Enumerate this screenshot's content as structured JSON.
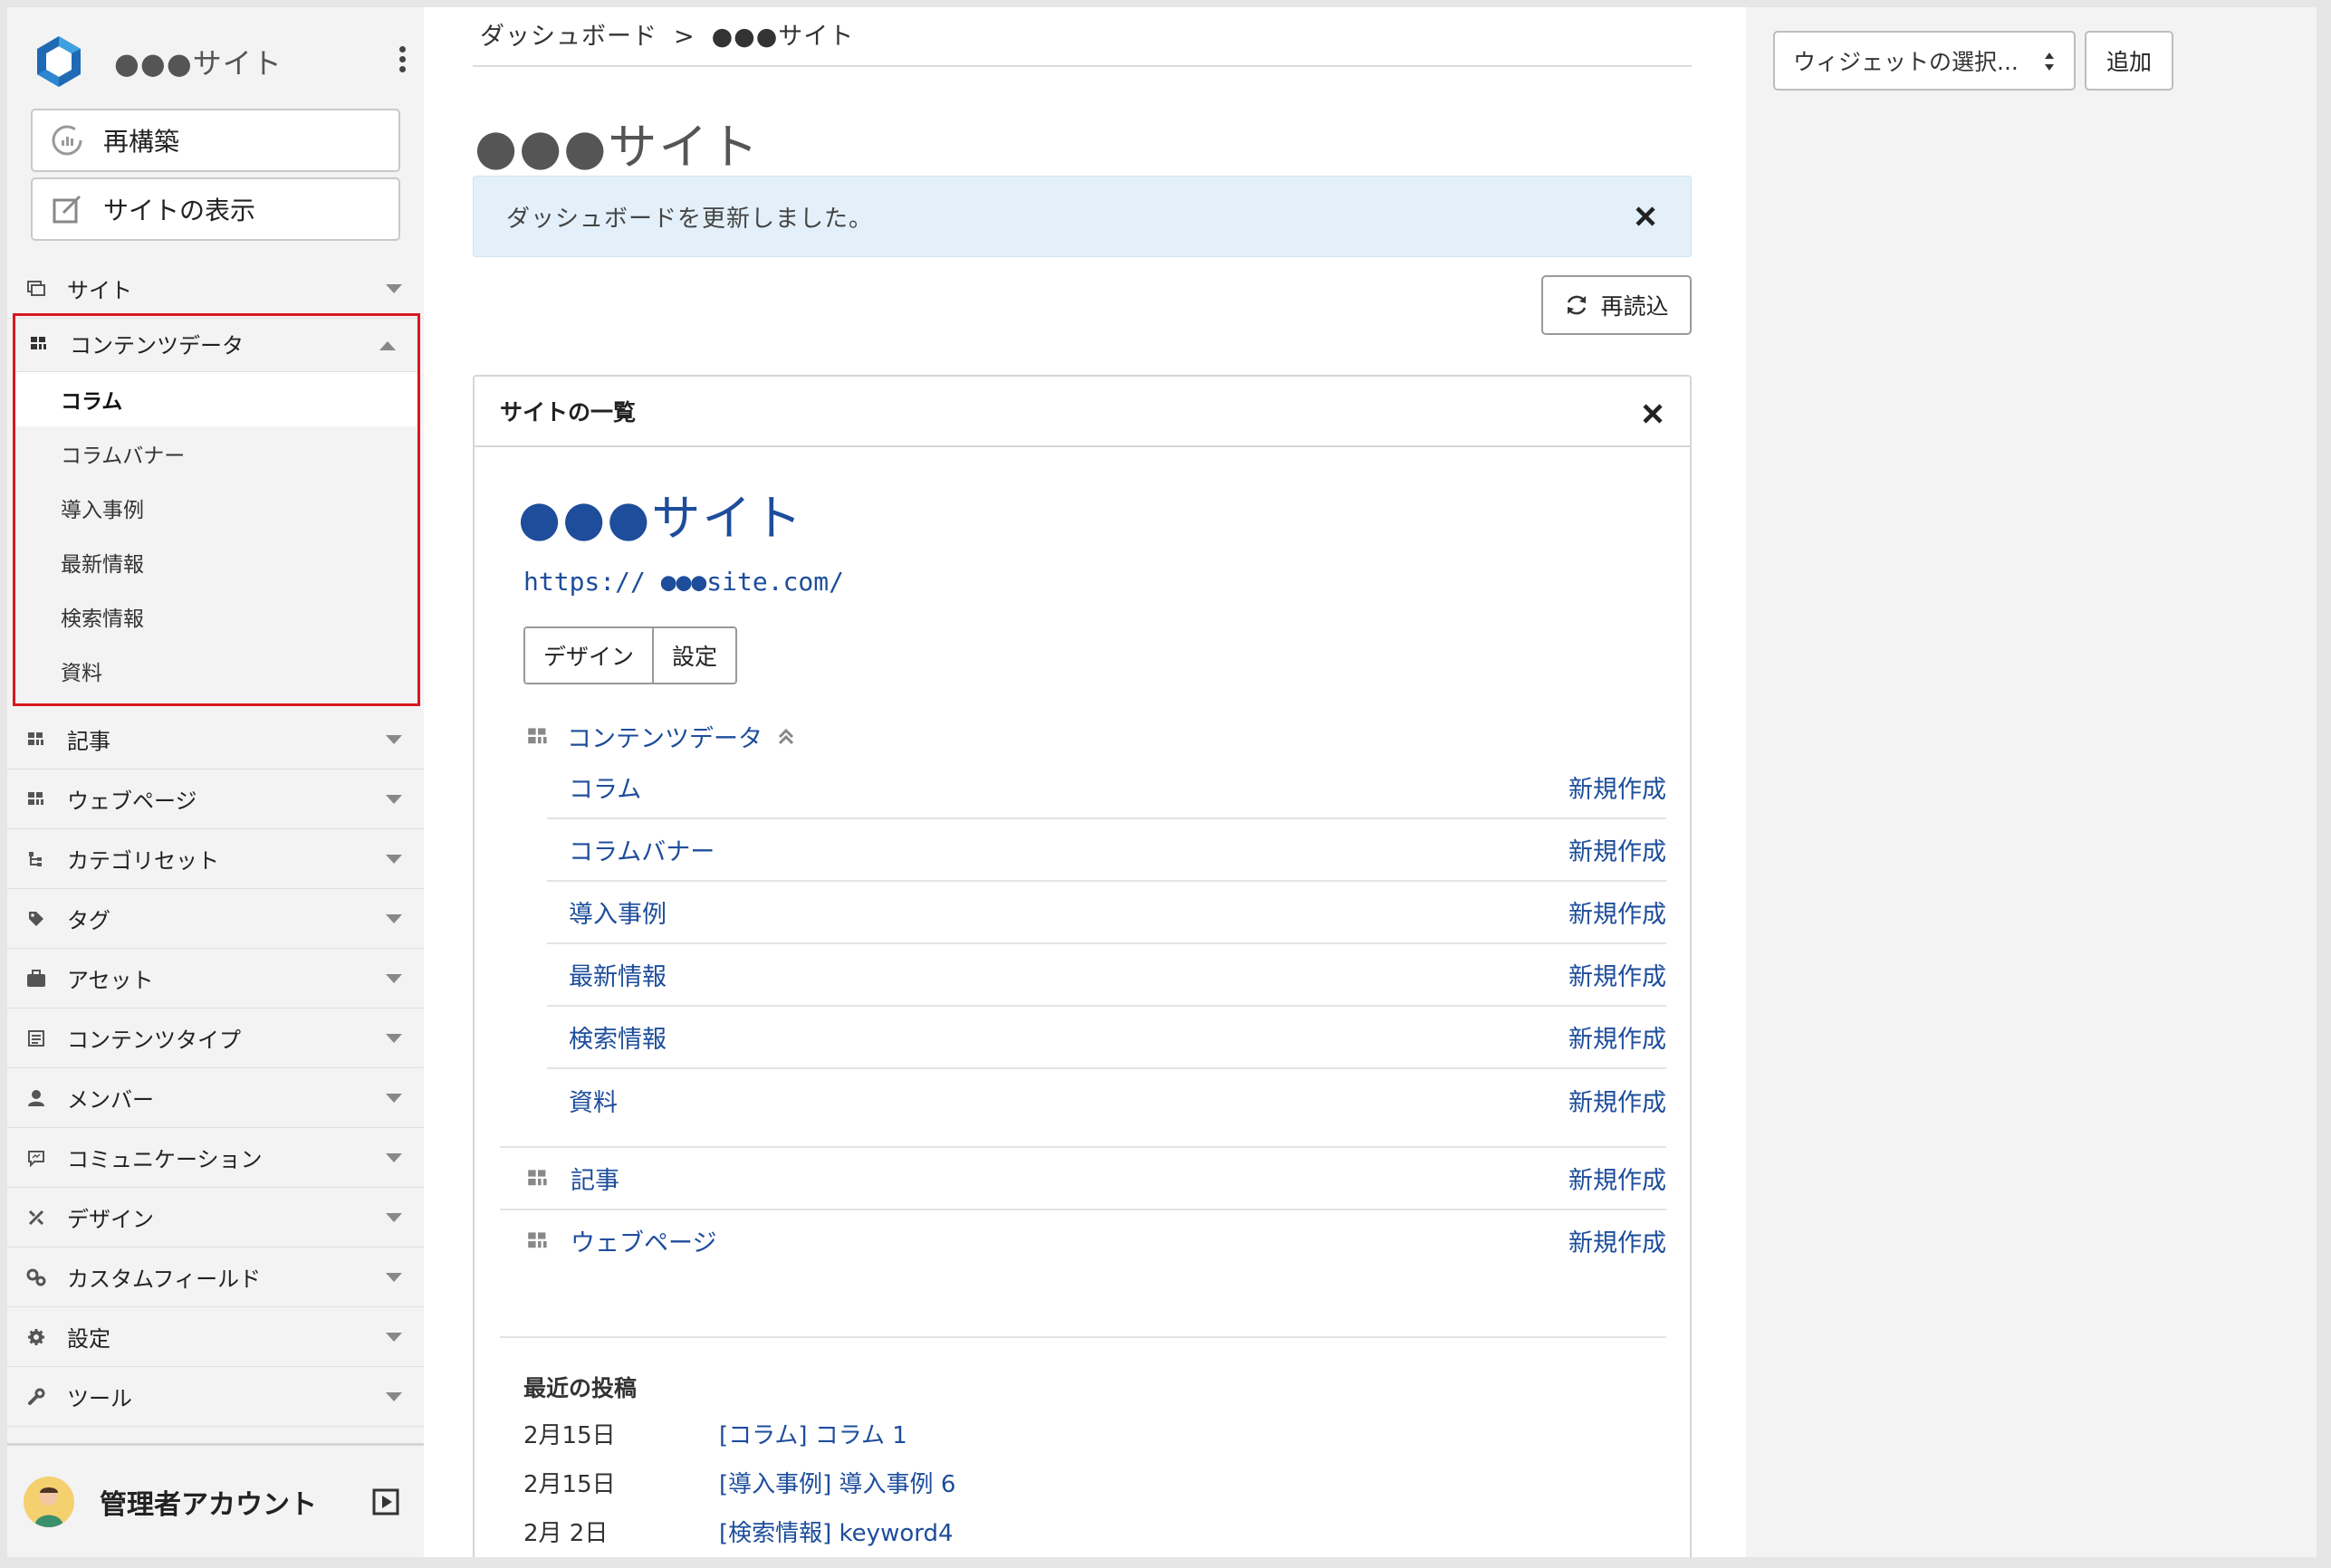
{
  "sidebar": {
    "site_title": "●●●サイト",
    "rebuild_label": "再構築",
    "view_site_label": "サイトの表示",
    "nav_site": "サイト",
    "content_data": {
      "label": "コンテンツデータ",
      "items": [
        "コラム",
        "コラムバナー",
        "導入事例",
        "最新情報",
        "検索情報",
        "資料"
      ],
      "active": "コラム"
    },
    "nav_items": [
      {
        "label": "記事",
        "icon": "grid-icon"
      },
      {
        "label": "ウェブページ",
        "icon": "grid-icon"
      },
      {
        "label": "カテゴリセット",
        "icon": "tree-icon"
      },
      {
        "label": "タグ",
        "icon": "tag-icon"
      },
      {
        "label": "アセット",
        "icon": "briefcase-icon"
      },
      {
        "label": "コンテンツタイプ",
        "icon": "content-type-icon"
      },
      {
        "label": "メンバー",
        "icon": "user-icon"
      },
      {
        "label": "コミュニケーション",
        "icon": "comment-icon"
      },
      {
        "label": "デザイン",
        "icon": "design-icon"
      },
      {
        "label": "カスタムフィールド",
        "icon": "gears-icon"
      },
      {
        "label": "設定",
        "icon": "gear-icon"
      },
      {
        "label": "ツール",
        "icon": "wrench-icon"
      }
    ],
    "account_name": "管理者アカウント"
  },
  "main": {
    "breadcrumb": [
      "ダッシュボード",
      "●●●サイト"
    ],
    "breadcrumb_sep": ">",
    "page_title": "●●●サイト",
    "alert_text": "ダッシュボードを更新しました。",
    "reload_label": "再読込",
    "panel": {
      "title": "サイトの一覧",
      "site_name": "●●●サイト",
      "site_url": "https:// ●●●site.com/",
      "design_label": "デザイン",
      "settings_label": "設定",
      "content_data_label": "コンテンツデータ",
      "content_rows": [
        "コラム",
        "コラムバナー",
        "導入事例",
        "最新情報",
        "検索情報",
        "資料"
      ],
      "new_label": "新規作成",
      "other_rows": [
        "記事",
        "ウェブページ"
      ],
      "recent_title": "最近の投稿",
      "recent": [
        {
          "date": "2月15日",
          "title": "[コラム] コラム 1"
        },
        {
          "date": "2月15日",
          "title": "[導入事例] 導入事例 6"
        },
        {
          "date": "2月 2日",
          "title": "[検索情報] keyword4"
        }
      ]
    }
  },
  "right": {
    "widget_select_label": "ウィジェットの選択...",
    "add_label": "追加"
  },
  "colors": {
    "accent": "#1d4d9b",
    "highlight_border": "#d71920",
    "alert_bg": "#e3f0f9"
  }
}
